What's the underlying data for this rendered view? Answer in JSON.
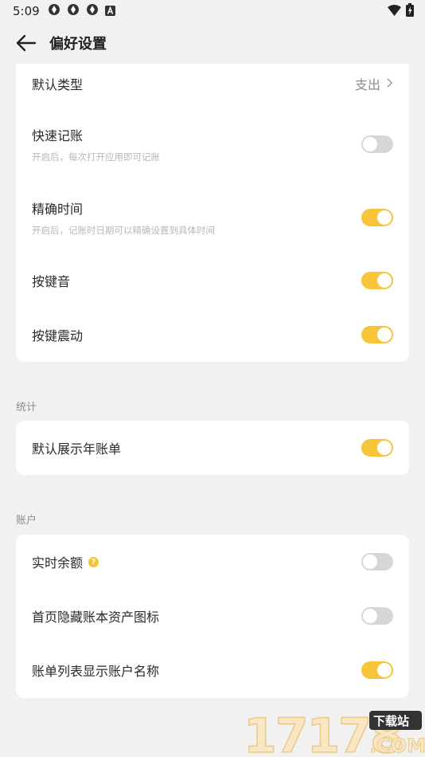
{
  "status": {
    "time": "5:09"
  },
  "header": {
    "title": "偏好设置"
  },
  "general": {
    "default_type": {
      "label": "默认类型",
      "value": "支出"
    },
    "quick_record": {
      "label": "快速记账",
      "sub": "开启后，每次打开应用即可记账",
      "on": false
    },
    "precise_time": {
      "label": "精确时间",
      "sub": "开启后，记账时日期可以精确设置到具体时间",
      "on": true
    },
    "key_sound": {
      "label": "按键音",
      "on": true
    },
    "key_vibrate": {
      "label": "按键震动",
      "on": true
    }
  },
  "stats": {
    "title": "统计",
    "show_year_bill": {
      "label": "默认展示年账单",
      "on": true
    }
  },
  "account": {
    "title": "账户",
    "realtime_balance": {
      "label": "实时余额",
      "on": false
    },
    "hide_asset_icon": {
      "label": "首页隐藏账本资产图标",
      "on": false
    },
    "show_account_name": {
      "label": "账单列表显示账户名称",
      "on": true
    }
  },
  "colors": {
    "accent": "#f7c43a",
    "toggle_off": "#d6d6d6",
    "background": "#f1f1f1"
  },
  "icons": [
    "back-arrow-icon",
    "chevron-right-icon",
    "help-icon"
  ],
  "watermark": {
    "text": "17178",
    "badge": "下载站",
    "suffix": ".COM"
  }
}
